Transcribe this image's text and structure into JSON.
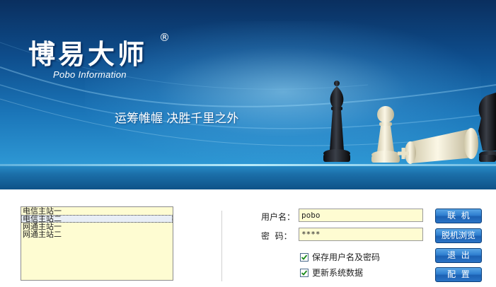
{
  "banner": {
    "logo_text": "博易大师",
    "registered_mark": "®",
    "subtitle": "Pobo Information",
    "slogan": "运筹帷幄  决胜千里之外"
  },
  "server_list": {
    "items": [
      "电信主站一",
      "电信主站二",
      "网通主站一",
      "网通主站二"
    ],
    "selected_index": 1
  },
  "login": {
    "username_label": "用户名：",
    "username_value": "pobo",
    "password_label": "密  码：",
    "password_value": "****"
  },
  "options": {
    "save_credentials_label": "保存用户名及密码",
    "save_credentials_checked": true,
    "update_data_label": "更新系统数据",
    "update_data_checked": true
  },
  "buttons": {
    "connect": "联  机",
    "offline_browse": "脱机浏览",
    "exit": "退  出",
    "config": "配  置"
  },
  "colors": {
    "field_background": "#fefcd2",
    "button_blue": "#2f7fd0",
    "banner_dark": "#0a2f5f"
  }
}
